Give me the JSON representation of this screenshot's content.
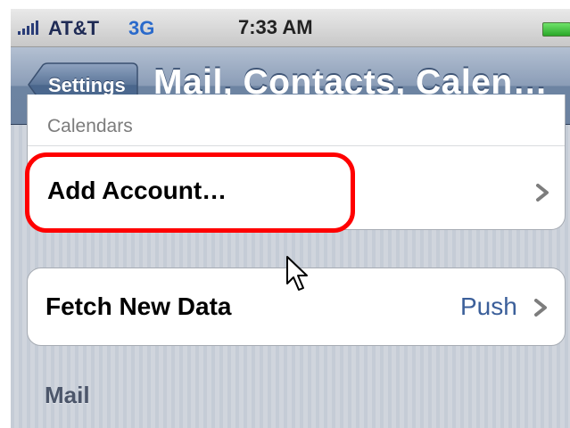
{
  "status_bar": {
    "carrier": "AT&T",
    "network": "3G",
    "time": "7:33 AM",
    "signal_bars": 5,
    "battery_level": 1.0
  },
  "nav_bar": {
    "back_label": "Settings",
    "title": "Mail, Contacts, Calen…"
  },
  "list": {
    "partial_row_label": "Calendars",
    "add_account_label": "Add Account…",
    "fetch_label": "Fetch New Data",
    "fetch_value": "Push",
    "mail_section_header": "Mail"
  },
  "colors": {
    "highlight": "#ff0000",
    "nav_bar": "#7d90ad",
    "value_text": "#3b5f9a",
    "network_text": "#2a6acb"
  },
  "icons": {
    "chevron": "chevron-right-icon",
    "cursor": "mouse-pointer-icon",
    "battery": "battery-icon",
    "signal": "signal-strength-icon"
  }
}
